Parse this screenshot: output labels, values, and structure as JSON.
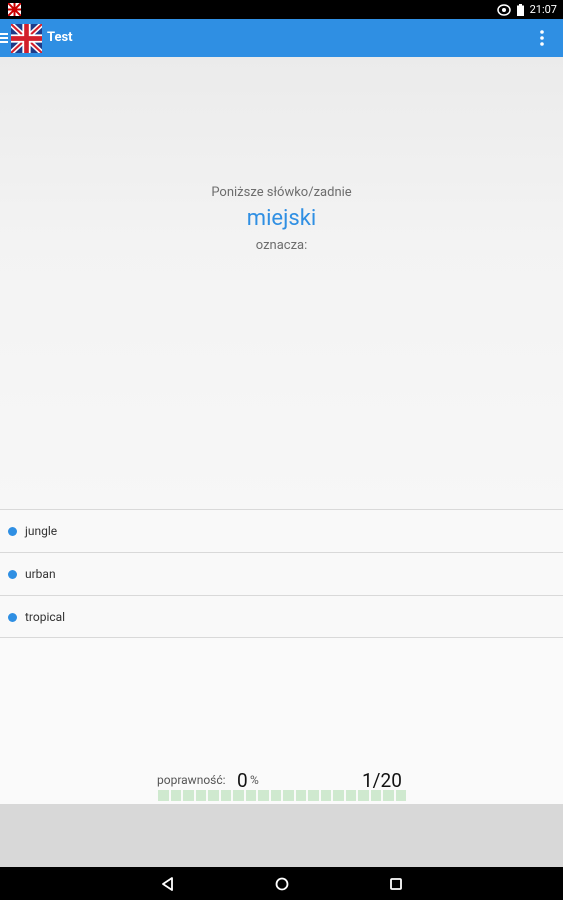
{
  "status_bar": {
    "time": "21:07",
    "colors": {
      "background": "#000000"
    }
  },
  "app_bar": {
    "title": "Test",
    "icons": {
      "menu": "menu-icon",
      "flag": "uk-flag-icon",
      "overflow": "overflow-menu-icon"
    },
    "colors": {
      "background": "#2f8fe3"
    }
  },
  "question": {
    "prompt": "Poniższe słówko/zadnie",
    "word": "miejski",
    "suffix": "oznacza:"
  },
  "answers": [
    {
      "label": "jungle"
    },
    {
      "label": "urban"
    },
    {
      "label": "tropical"
    }
  ],
  "stats": {
    "label": "poprawność:",
    "percent_value": "0",
    "percent_sign": "%",
    "progress_text": "1/20",
    "progress_fraction": 0.05,
    "segments": 20
  },
  "nav_bar": {
    "icons": [
      "back-icon",
      "home-icon",
      "recents-icon"
    ]
  }
}
